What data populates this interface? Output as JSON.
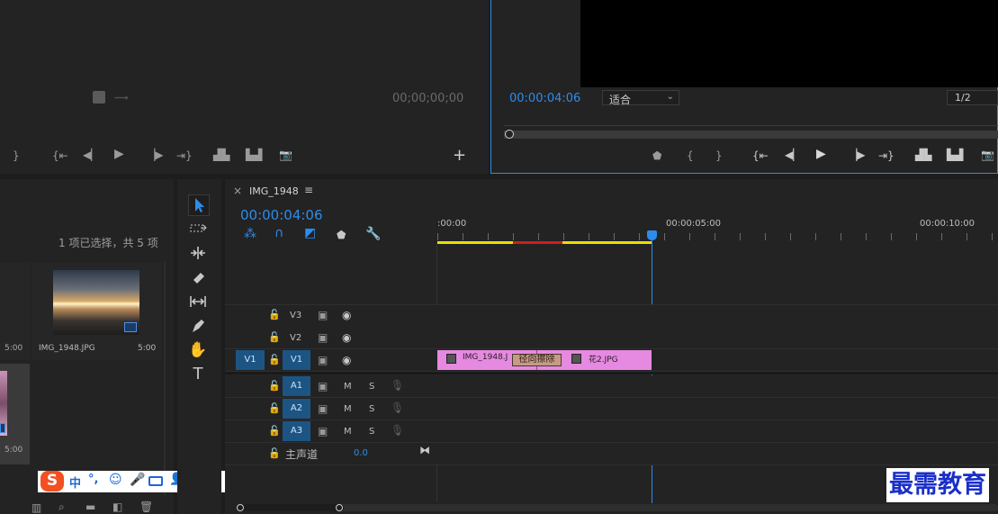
{
  "source_monitor": {
    "timecode": "00;00;00;00"
  },
  "program_monitor": {
    "timecode": "00:00:04:06",
    "zoom_select": "适合",
    "resolution_select": "1/2"
  },
  "project": {
    "selection_status": "1 项已选择，共 5 项",
    "item1": {
      "name": "IMG_1948.JPG",
      "duration": "5:00"
    },
    "item0_duration": "5:00",
    "item2_duration": "5:00"
  },
  "timeline": {
    "close": "×",
    "sequence_name": "IMG_1948",
    "menu": "≡",
    "timecode": "00:00:04:06",
    "ruler": [
      ":00:00",
      "00:00:05:00",
      "00:00:10:00"
    ],
    "tracks": {
      "v3": "V3",
      "v2": "V2",
      "v1": "V1",
      "v1_source": "V1",
      "a1": "A1",
      "a2": "A2",
      "a3": "A3",
      "mute": "M",
      "solo": "S",
      "master": "主声道",
      "master_value": "0.0"
    },
    "clips": {
      "clip1": "IMG_1948.J",
      "transition": "径向擦除",
      "clip2": "花2.JPG"
    }
  },
  "ime": {
    "lang": "中",
    "punct": "°,"
  },
  "watermark": "最需教育",
  "colors": {
    "accent_blue": "#2d8ceb",
    "clip_pink": "#e58ae0",
    "work_area_yellow": "#e8e000",
    "render_red": "#d01d1d"
  }
}
